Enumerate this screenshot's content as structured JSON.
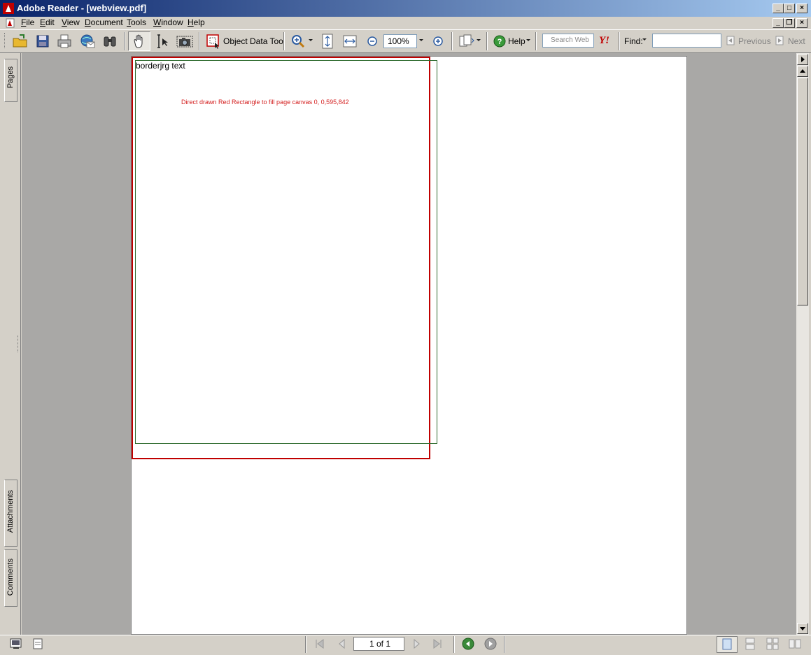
{
  "window": {
    "title": "Adobe Reader - [webview.pdf]",
    "controls": {
      "minimize": "_",
      "maximize": "□",
      "close": "×"
    },
    "doc_controls": {
      "minimize": "_",
      "restore": "❐",
      "close": "×"
    }
  },
  "menu": [
    {
      "key": "F",
      "rest": "ile"
    },
    {
      "key": "E",
      "rest": "dit"
    },
    {
      "key": "V",
      "rest": "iew"
    },
    {
      "key": "D",
      "rest": "ocument"
    },
    {
      "key": "T",
      "rest": "ools"
    },
    {
      "key": "W",
      "rest": "indow"
    },
    {
      "key": "H",
      "rest": "elp"
    }
  ],
  "toolbar": {
    "object_data_tool": "Object Data Tool",
    "zoom_value": "100%",
    "help_label": "Help",
    "search_web_placeholder": "Search Web",
    "yahoo_label": "Y!",
    "find_label": "Find:",
    "find_value": "",
    "previous_label": "Previous",
    "next_label": "Next"
  },
  "sidebar": {
    "tabs": [
      "Pages",
      "Attachments",
      "Comments"
    ]
  },
  "page_content": {
    "text_heading": "borderjrg text",
    "red_caption": "Direct drawn Red Rectangle to fill page canvas 0, 0,595,842"
  },
  "status": {
    "page_indicator": "1 of 1"
  },
  "colors": {
    "title_bar_start": "#0a246a",
    "title_bar_end": "#a6caf0",
    "red_rect": "#c00000",
    "green_rect": "#2e6b2e",
    "red_text": "#d42020",
    "doc_bg": "#a9a8a6"
  }
}
